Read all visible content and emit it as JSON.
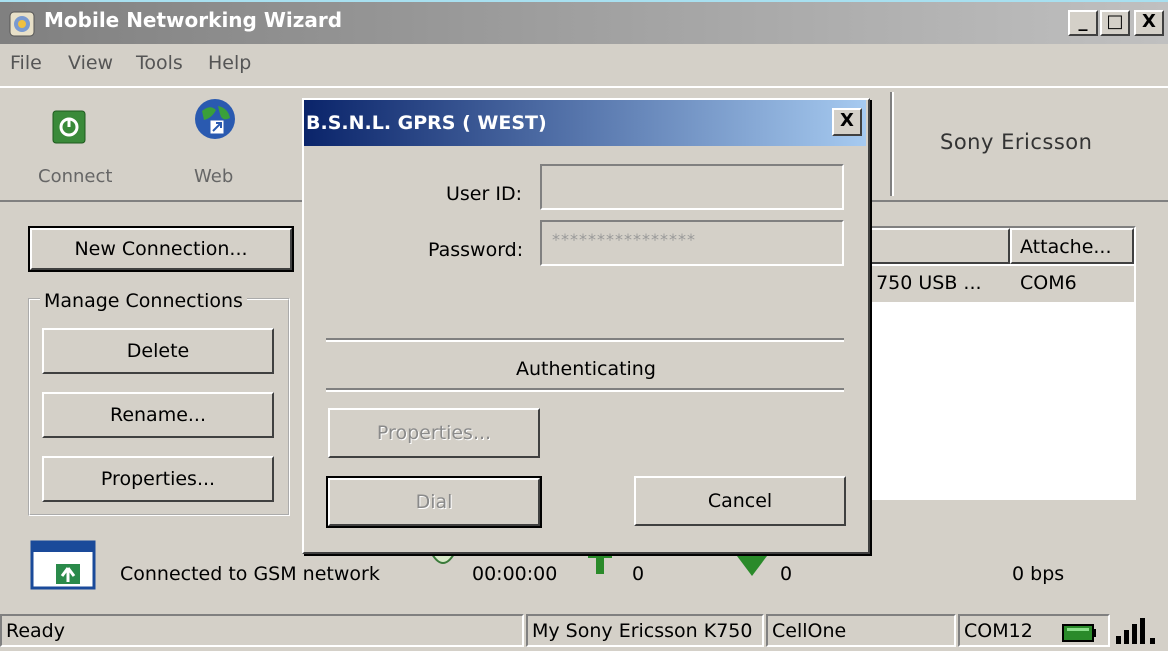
{
  "window": {
    "title": "Mobile Networking Wizard",
    "controls": {
      "minimize": "_",
      "maximize": "□",
      "close": "X"
    }
  },
  "menu": [
    "File",
    "View",
    "Tools",
    "Help"
  ],
  "toolbar": {
    "connect_label": "Connect",
    "connect_icon": "power-icon",
    "web_label": "Web",
    "web_icon": "globe-icon",
    "brand": "Sony Ericsson"
  },
  "left_panel": {
    "new_connection": "New Connection...",
    "manage_group": "Manage  Connections",
    "delete": "Delete",
    "rename": "Rename...",
    "properties": "Properties..."
  },
  "list": {
    "columns": [
      "Attache..."
    ],
    "row": {
      "device": "h 750 USB ...",
      "port": "COM6"
    }
  },
  "status_area": {
    "message": "Connected to GSM network",
    "timer": "00:00:00",
    "sent": "0",
    "received": "0",
    "speed": "0 bps"
  },
  "statusbar": {
    "ready": "Ready",
    "phone": "My Sony Ericsson K750",
    "operator": "CellOne",
    "port": "COM12"
  },
  "dialog": {
    "title": "B.S.N.L. GPRS ( WEST)",
    "close": "X",
    "user_id_label": "User ID:",
    "user_id_value": "",
    "password_label": "Password:",
    "password_value": "****************",
    "status": "Authenticating",
    "properties": "Properties...",
    "dial": "Dial",
    "cancel": "Cancel"
  },
  "colors": {
    "title_inactive": "#808080",
    "dialog_title": "#0a246a",
    "face": "#d4d0c8"
  }
}
